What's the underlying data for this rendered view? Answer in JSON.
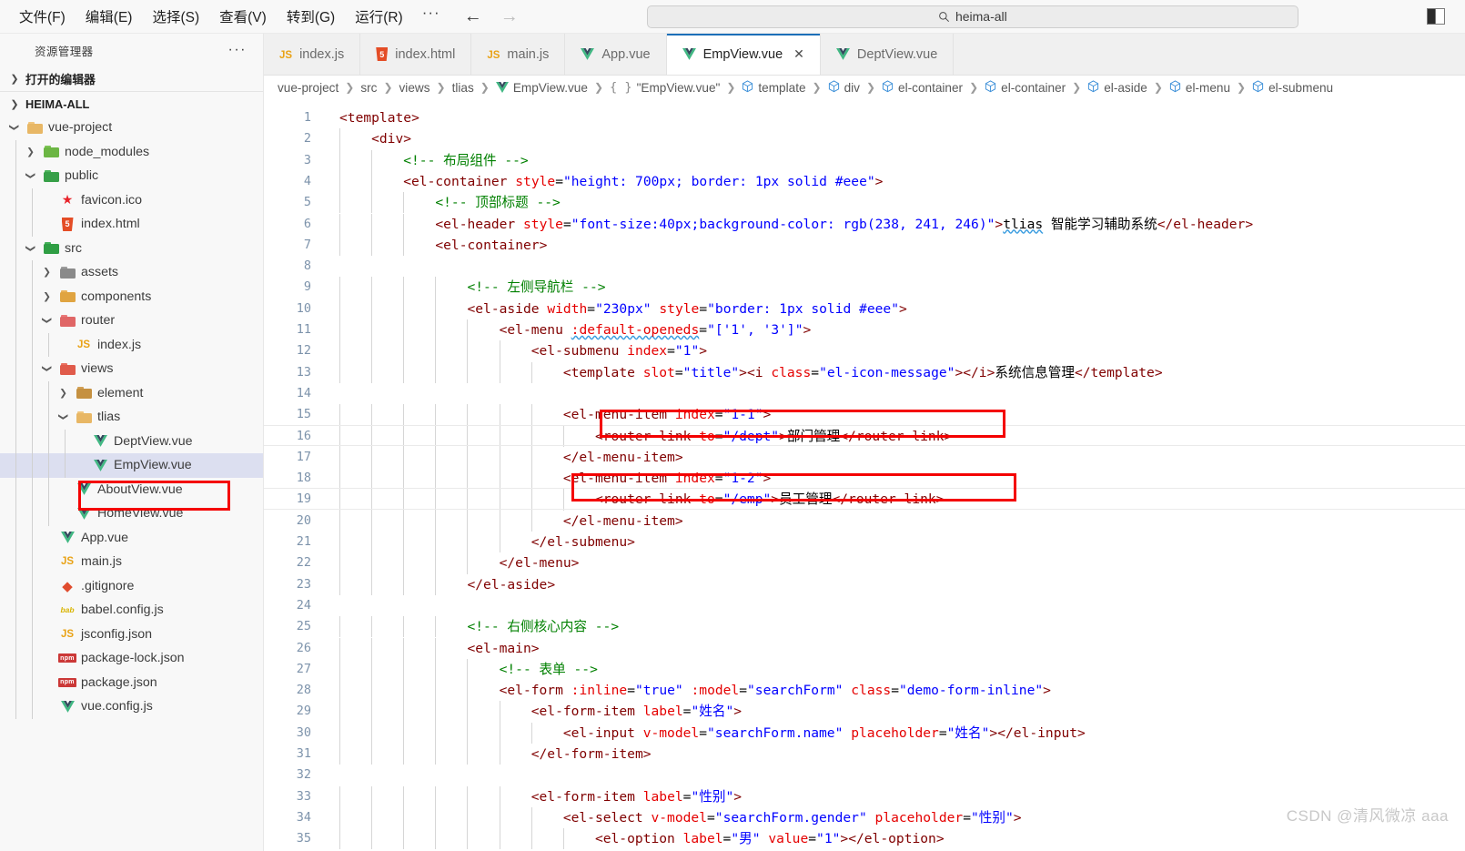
{
  "window": {
    "menu": [
      {
        "label": "文件(F)"
      },
      {
        "label": "编辑(E)"
      },
      {
        "label": "选择(S)"
      },
      {
        "label": "查看(V)"
      },
      {
        "label": "转到(G)"
      },
      {
        "label": "运行(R)"
      }
    ],
    "menu_more": "···",
    "back_arrow": "←",
    "forward_arrow": "→",
    "search_value": "heima-all",
    "layout_toggle_name": "toggle-panel-layout"
  },
  "sidebar": {
    "title": "资源管理器",
    "more": "···",
    "open_editors": "打开的编辑器",
    "root": "HEIMA-ALL",
    "tree": [
      {
        "label": "vue-project",
        "indent": 1,
        "type": "folder-open",
        "color": "#e8b765",
        "twisty": "v"
      },
      {
        "label": "node_modules",
        "indent": 2,
        "type": "folder-node",
        "color": "#6cb644",
        "twisty": ">"
      },
      {
        "label": "public",
        "indent": 2,
        "type": "folder-public",
        "color": "#37a048",
        "twisty": "v"
      },
      {
        "label": "favicon.ico",
        "indent": 3,
        "type": "ico",
        "twisty": ""
      },
      {
        "label": "index.html",
        "indent": 3,
        "type": "html",
        "twisty": ""
      },
      {
        "label": "src",
        "indent": 2,
        "type": "folder-src",
        "color": "#2f9e44",
        "twisty": "v"
      },
      {
        "label": "assets",
        "indent": 3,
        "type": "folder-assets",
        "color": "#8a8a8a",
        "twisty": ">"
      },
      {
        "label": "components",
        "indent": 3,
        "type": "folder-comp",
        "color": "#e0a441",
        "twisty": ">"
      },
      {
        "label": "router",
        "indent": 3,
        "type": "folder-router",
        "color": "#e06666",
        "twisty": "v"
      },
      {
        "label": "index.js",
        "indent": 4,
        "type": "js",
        "twisty": ""
      },
      {
        "label": "views",
        "indent": 3,
        "type": "folder-views",
        "color": "#e05b4b",
        "twisty": "v"
      },
      {
        "label": "element",
        "indent": 4,
        "type": "folder-plain",
        "color": "#c59141",
        "twisty": ">"
      },
      {
        "label": "tlias",
        "indent": 4,
        "type": "folder-open",
        "color": "#e8b765",
        "twisty": "v"
      },
      {
        "label": "DeptView.vue",
        "indent": 5,
        "type": "vue",
        "twisty": ""
      },
      {
        "label": "EmpView.vue",
        "indent": 5,
        "type": "vue",
        "twisty": "",
        "selected": true,
        "annotated": true
      },
      {
        "label": "AboutView.vue",
        "indent": 4,
        "type": "vue",
        "twisty": ""
      },
      {
        "label": "HomeView.vue",
        "indent": 4,
        "type": "vue",
        "twisty": ""
      },
      {
        "label": "App.vue",
        "indent": 3,
        "type": "vue",
        "twisty": ""
      },
      {
        "label": "main.js",
        "indent": 3,
        "type": "js",
        "twisty": ""
      },
      {
        "label": ".gitignore",
        "indent": 3,
        "type": "git",
        "twisty": ""
      },
      {
        "label": "babel.config.js",
        "indent": 3,
        "type": "babel",
        "twisty": ""
      },
      {
        "label": "jsconfig.json",
        "indent": 3,
        "type": "js",
        "twisty": ""
      },
      {
        "label": "package-lock.json",
        "indent": 3,
        "type": "npm",
        "twisty": ""
      },
      {
        "label": "package.json",
        "indent": 3,
        "type": "npm",
        "twisty": ""
      },
      {
        "label": "vue.config.js",
        "indent": 3,
        "type": "vue",
        "twisty": ""
      }
    ]
  },
  "tabs": [
    {
      "label": "index.js",
      "type": "js",
      "active": false
    },
    {
      "label": "index.html",
      "type": "html",
      "active": false
    },
    {
      "label": "main.js",
      "type": "js",
      "active": false
    },
    {
      "label": "App.vue",
      "type": "vue",
      "active": false
    },
    {
      "label": "EmpView.vue",
      "type": "vue",
      "active": true,
      "close": "✕"
    },
    {
      "label": "DeptView.vue",
      "type": "vue",
      "active": false
    }
  ],
  "breadcrumb": [
    {
      "label": "vue-project",
      "icon": "none"
    },
    {
      "label": "src",
      "icon": "none"
    },
    {
      "label": "views",
      "icon": "none"
    },
    {
      "label": "tlias",
      "icon": "none"
    },
    {
      "label": "EmpView.vue",
      "icon": "vue"
    },
    {
      "label": "\"EmpView.vue\"",
      "icon": "braces"
    },
    {
      "label": "template",
      "icon": "cube"
    },
    {
      "label": "div",
      "icon": "cube"
    },
    {
      "label": "el-container",
      "icon": "cube"
    },
    {
      "label": "el-container",
      "icon": "cube"
    },
    {
      "label": "el-aside",
      "icon": "cube"
    },
    {
      "label": "el-menu",
      "icon": "cube"
    },
    {
      "label": "el-submenu",
      "icon": "cube"
    }
  ],
  "editor": {
    "file": "EmpView.vue",
    "first_line": 1,
    "lines": [
      {
        "n": 1,
        "indent": 0,
        "tokens": [
          {
            "t": "tag",
            "v": "<template>"
          }
        ]
      },
      {
        "n": 2,
        "indent": 1,
        "tokens": [
          {
            "t": "tag",
            "v": "<div>"
          }
        ]
      },
      {
        "n": 3,
        "indent": 2,
        "tokens": [
          {
            "t": "com",
            "v": "<!-- 布局组件 -->"
          }
        ]
      },
      {
        "n": 4,
        "indent": 2,
        "tokens": [
          {
            "t": "tag",
            "v": "<el-container "
          },
          {
            "t": "attr",
            "v": "style"
          },
          {
            "t": "pun",
            "v": "="
          },
          {
            "t": "val",
            "v": "\"height: 700px; border: 1px solid #eee\""
          },
          {
            "t": "tag",
            "v": ">"
          }
        ]
      },
      {
        "n": 5,
        "indent": 3,
        "tokens": [
          {
            "t": "com",
            "v": "<!-- 顶部标题 -->"
          }
        ]
      },
      {
        "n": 6,
        "indent": 3,
        "tokens": [
          {
            "t": "tag",
            "v": "<el-header "
          },
          {
            "t": "attr",
            "v": "style"
          },
          {
            "t": "pun",
            "v": "="
          },
          {
            "t": "val",
            "v": "\"font-size:40px;background-color: rgb(238, 241, 246)\""
          },
          {
            "t": "tag",
            "v": ">"
          },
          {
            "t": "squig",
            "v": "tlias"
          },
          {
            "t": "txt",
            "v": " 智能学习辅助系统"
          },
          {
            "t": "tag",
            "v": "</el-header>"
          }
        ]
      },
      {
        "n": 7,
        "indent": 3,
        "tokens": [
          {
            "t": "tag",
            "v": "<el-container>"
          }
        ]
      },
      {
        "n": 8,
        "indent": 0,
        "tokens": []
      },
      {
        "n": 9,
        "indent": 4,
        "tokens": [
          {
            "t": "com",
            "v": "<!-- 左侧导航栏 -->"
          }
        ]
      },
      {
        "n": 10,
        "indent": 4,
        "tokens": [
          {
            "t": "tag",
            "v": "<el-aside "
          },
          {
            "t": "attr",
            "v": "width"
          },
          {
            "t": "pun",
            "v": "="
          },
          {
            "t": "val",
            "v": "\"230px\""
          },
          {
            "t": "txt",
            "v": " "
          },
          {
            "t": "attr",
            "v": "style"
          },
          {
            "t": "pun",
            "v": "="
          },
          {
            "t": "val",
            "v": "\"border: 1px solid #eee\""
          },
          {
            "t": "tag",
            "v": ">"
          }
        ]
      },
      {
        "n": 11,
        "indent": 5,
        "tokens": [
          {
            "t": "tag",
            "v": "<el-menu "
          },
          {
            "t": "attrsquig",
            "v": ":default-openeds"
          },
          {
            "t": "pun",
            "v": "="
          },
          {
            "t": "val",
            "v": "\"['1', '3']\""
          },
          {
            "t": "tag",
            "v": ">"
          }
        ]
      },
      {
        "n": 12,
        "indent": 6,
        "tokens": [
          {
            "t": "tag",
            "v": "<el-submenu "
          },
          {
            "t": "attr",
            "v": "index"
          },
          {
            "t": "pun",
            "v": "="
          },
          {
            "t": "val",
            "v": "\"1\""
          },
          {
            "t": "tag",
            "v": ">"
          }
        ]
      },
      {
        "n": 13,
        "indent": 7,
        "tokens": [
          {
            "t": "tag",
            "v": "<template "
          },
          {
            "t": "attr",
            "v": "slot"
          },
          {
            "t": "pun",
            "v": "="
          },
          {
            "t": "val",
            "v": "\"title\""
          },
          {
            "t": "tag",
            "v": "><i "
          },
          {
            "t": "attr",
            "v": "class"
          },
          {
            "t": "pun",
            "v": "="
          },
          {
            "t": "val",
            "v": "\"el-icon-message\""
          },
          {
            "t": "tag",
            "v": "></i>"
          },
          {
            "t": "txt",
            "v": "系统信息管理"
          },
          {
            "t": "tag",
            "v": "</template>"
          }
        ]
      },
      {
        "n": 14,
        "indent": 0,
        "tokens": []
      },
      {
        "n": 15,
        "indent": 7,
        "tokens": [
          {
            "t": "tag",
            "v": "<el-menu-item "
          },
          {
            "t": "attr",
            "v": "index"
          },
          {
            "t": "pun",
            "v": "="
          },
          {
            "t": "val",
            "v": "\"1-1\""
          },
          {
            "t": "tag",
            "v": ">"
          }
        ]
      },
      {
        "n": 16,
        "indent": 8,
        "tokens": [
          {
            "t": "tag",
            "v": "<router-link "
          },
          {
            "t": "attr",
            "v": "to"
          },
          {
            "t": "pun",
            "v": "="
          },
          {
            "t": "val",
            "v": "\"/dept\""
          },
          {
            "t": "tag",
            "v": ">"
          },
          {
            "t": "txt",
            "v": "部门管理"
          },
          {
            "t": "tag",
            "v": "</router-link>"
          }
        ]
      },
      {
        "n": 17,
        "indent": 7,
        "tokens": [
          {
            "t": "tag",
            "v": "</el-menu-item>"
          }
        ]
      },
      {
        "n": 18,
        "indent": 7,
        "tokens": [
          {
            "t": "tag",
            "v": "<el-menu-item "
          },
          {
            "t": "attr",
            "v": "index"
          },
          {
            "t": "pun",
            "v": "="
          },
          {
            "t": "val",
            "v": "\"1-2\""
          },
          {
            "t": "tag",
            "v": ">"
          }
        ]
      },
      {
        "n": 19,
        "indent": 8,
        "tokens": [
          {
            "t": "tag",
            "v": "<router-link "
          },
          {
            "t": "attr",
            "v": "to"
          },
          {
            "t": "pun",
            "v": "="
          },
          {
            "t": "val",
            "v": "\"/emp\""
          },
          {
            "t": "tag",
            "v": ">"
          },
          {
            "t": "txt",
            "v": "员工管理"
          },
          {
            "t": "tag",
            "v": "</router-link>"
          }
        ]
      },
      {
        "n": 20,
        "indent": 7,
        "tokens": [
          {
            "t": "tag",
            "v": "</el-menu-item>"
          }
        ]
      },
      {
        "n": 21,
        "indent": 6,
        "tokens": [
          {
            "t": "tag",
            "v": "</el-submenu>"
          }
        ]
      },
      {
        "n": 22,
        "indent": 5,
        "tokens": [
          {
            "t": "tag",
            "v": "</el-menu>"
          }
        ]
      },
      {
        "n": 23,
        "indent": 4,
        "tokens": [
          {
            "t": "tag",
            "v": "</el-aside>"
          }
        ]
      },
      {
        "n": 24,
        "indent": 0,
        "tokens": []
      },
      {
        "n": 25,
        "indent": 4,
        "tokens": [
          {
            "t": "com",
            "v": "<!-- 右侧核心内容 -->"
          }
        ]
      },
      {
        "n": 26,
        "indent": 4,
        "tokens": [
          {
            "t": "tag",
            "v": "<el-main>"
          }
        ]
      },
      {
        "n": 27,
        "indent": 5,
        "tokens": [
          {
            "t": "com",
            "v": "<!-- 表单 -->"
          }
        ]
      },
      {
        "n": 28,
        "indent": 5,
        "tokens": [
          {
            "t": "tag",
            "v": "<el-form "
          },
          {
            "t": "attr",
            "v": ":inline"
          },
          {
            "t": "pun",
            "v": "="
          },
          {
            "t": "val",
            "v": "\"true\""
          },
          {
            "t": "txt",
            "v": " "
          },
          {
            "t": "attr",
            "v": ":model"
          },
          {
            "t": "pun",
            "v": "="
          },
          {
            "t": "val",
            "v": "\"searchForm\""
          },
          {
            "t": "txt",
            "v": " "
          },
          {
            "t": "attr",
            "v": "class"
          },
          {
            "t": "pun",
            "v": "="
          },
          {
            "t": "val",
            "v": "\"demo-form-inline\""
          },
          {
            "t": "tag",
            "v": ">"
          }
        ]
      },
      {
        "n": 29,
        "indent": 6,
        "tokens": [
          {
            "t": "tag",
            "v": "<el-form-item "
          },
          {
            "t": "attr",
            "v": "label"
          },
          {
            "t": "pun",
            "v": "="
          },
          {
            "t": "val",
            "v": "\"姓名\""
          },
          {
            "t": "tag",
            "v": ">"
          }
        ]
      },
      {
        "n": 30,
        "indent": 7,
        "tokens": [
          {
            "t": "tag",
            "v": "<el-input "
          },
          {
            "t": "attr",
            "v": "v-model"
          },
          {
            "t": "pun",
            "v": "="
          },
          {
            "t": "val",
            "v": "\"searchForm.name\""
          },
          {
            "t": "txt",
            "v": " "
          },
          {
            "t": "attr",
            "v": "placeholder"
          },
          {
            "t": "pun",
            "v": "="
          },
          {
            "t": "val",
            "v": "\"姓名\""
          },
          {
            "t": "tag",
            "v": "></el-input>"
          }
        ]
      },
      {
        "n": 31,
        "indent": 6,
        "tokens": [
          {
            "t": "tag",
            "v": "</el-form-item>"
          }
        ]
      },
      {
        "n": 32,
        "indent": 0,
        "tokens": []
      },
      {
        "n": 33,
        "indent": 6,
        "tokens": [
          {
            "t": "tag",
            "v": "<el-form-item "
          },
          {
            "t": "attr",
            "v": "label"
          },
          {
            "t": "pun",
            "v": "="
          },
          {
            "t": "val",
            "v": "\"性别\""
          },
          {
            "t": "tag",
            "v": ">"
          }
        ]
      },
      {
        "n": 34,
        "indent": 7,
        "tokens": [
          {
            "t": "tag",
            "v": "<el-select "
          },
          {
            "t": "attr",
            "v": "v-model"
          },
          {
            "t": "pun",
            "v": "="
          },
          {
            "t": "val",
            "v": "\"searchForm.gender\""
          },
          {
            "t": "txt",
            "v": " "
          },
          {
            "t": "attr",
            "v": "placeholder"
          },
          {
            "t": "pun",
            "v": "="
          },
          {
            "t": "val",
            "v": "\"性别\""
          },
          {
            "t": "tag",
            "v": ">"
          }
        ]
      },
      {
        "n": 35,
        "indent": 8,
        "tokens": [
          {
            "t": "tag",
            "v": "<el-option "
          },
          {
            "t": "attr",
            "v": "label"
          },
          {
            "t": "pun",
            "v": "="
          },
          {
            "t": "val",
            "v": "\"男\""
          },
          {
            "t": "txt",
            "v": " "
          },
          {
            "t": "attr",
            "v": "value"
          },
          {
            "t": "pun",
            "v": "="
          },
          {
            "t": "val",
            "v": "\"1\""
          },
          {
            "t": "tag",
            "v": "></el-option>"
          }
        ]
      }
    ],
    "annotations": [
      {
        "line": 16,
        "name": "dept-router-link-highlight"
      },
      {
        "line": 19,
        "name": "emp-router-link-highlight"
      }
    ]
  },
  "watermark": "CSDN @清风微凉 aaa",
  "colors": {
    "accent": "#1c6fb8",
    "annotation": "#f40000",
    "selection": "#dcdff0",
    "tag": "#800000",
    "attribute": "#e50000",
    "value": "#0000ff",
    "comment": "#008000"
  }
}
